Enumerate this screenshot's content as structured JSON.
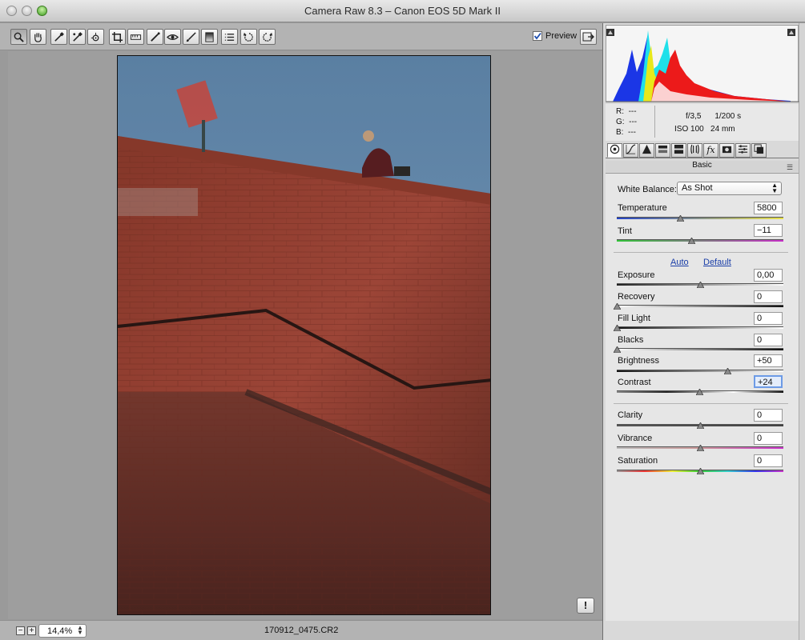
{
  "window": {
    "title": "Camera Raw 8.3  –  Canon EOS 5D Mark II"
  },
  "toolbar": {
    "tools": [
      {
        "name": "zoom-tool-icon"
      },
      {
        "name": "hand-tool-icon"
      },
      {
        "name": "white-balance-tool-icon"
      },
      {
        "name": "color-sampler-tool-icon"
      },
      {
        "name": "targeted-adjustment-tool-icon"
      },
      {
        "name": "crop-tool-icon"
      },
      {
        "name": "straighten-tool-icon"
      },
      {
        "name": "spot-removal-tool-icon"
      },
      {
        "name": "red-eye-removal-icon"
      },
      {
        "name": "adjustment-brush-icon"
      },
      {
        "name": "graduated-filter-icon"
      },
      {
        "name": "preferences-icon"
      },
      {
        "name": "rotate-ccw-icon"
      },
      {
        "name": "rotate-cw-icon"
      }
    ],
    "preview_label": "Preview",
    "preview_checked": true
  },
  "canvas": {
    "warning_symbol": "!"
  },
  "status": {
    "zoom": "14,4%",
    "filename": "170912_0475.CR2",
    "zoom_out": "−",
    "zoom_in": "+"
  },
  "info": {
    "r_label": "R:",
    "r_value": "---",
    "g_label": "G:",
    "g_value": "---",
    "b_label": "B:",
    "b_value": "---",
    "aperture": "f/3,5",
    "shutter": "1/200 s",
    "iso": "ISO 100",
    "focal": "24 mm"
  },
  "panel": {
    "section_title": "Basic",
    "white_balance_label": "White Balance:",
    "white_balance_value": "As Shot",
    "auto_label": "Auto",
    "default_label": "Default",
    "sliders": {
      "temperature": {
        "label": "Temperature",
        "value": "5800",
        "position": 0.38
      },
      "tint": {
        "label": "Tint",
        "value": "−11",
        "position": 0.45
      },
      "exposure": {
        "label": "Exposure",
        "value": "0,00",
        "position": 0.5
      },
      "recovery": {
        "label": "Recovery",
        "value": "0",
        "position": 0.0
      },
      "fill_light": {
        "label": "Fill Light",
        "value": "0",
        "position": 0.0
      },
      "blacks": {
        "label": "Blacks",
        "value": "0",
        "position": 0.0
      },
      "brightness": {
        "label": "Brightness",
        "value": "+50",
        "position": 0.65
      },
      "contrast": {
        "label": "Contrast",
        "value": "+24",
        "position": 0.49
      },
      "clarity": {
        "label": "Clarity",
        "value": "0",
        "position": 0.5
      },
      "vibrance": {
        "label": "Vibrance",
        "value": "0",
        "position": 0.5
      },
      "saturation": {
        "label": "Saturation",
        "value": "0",
        "position": 0.5
      }
    }
  },
  "colors": {
    "accent": "#6d9be6",
    "link": "#1a3ea8"
  }
}
